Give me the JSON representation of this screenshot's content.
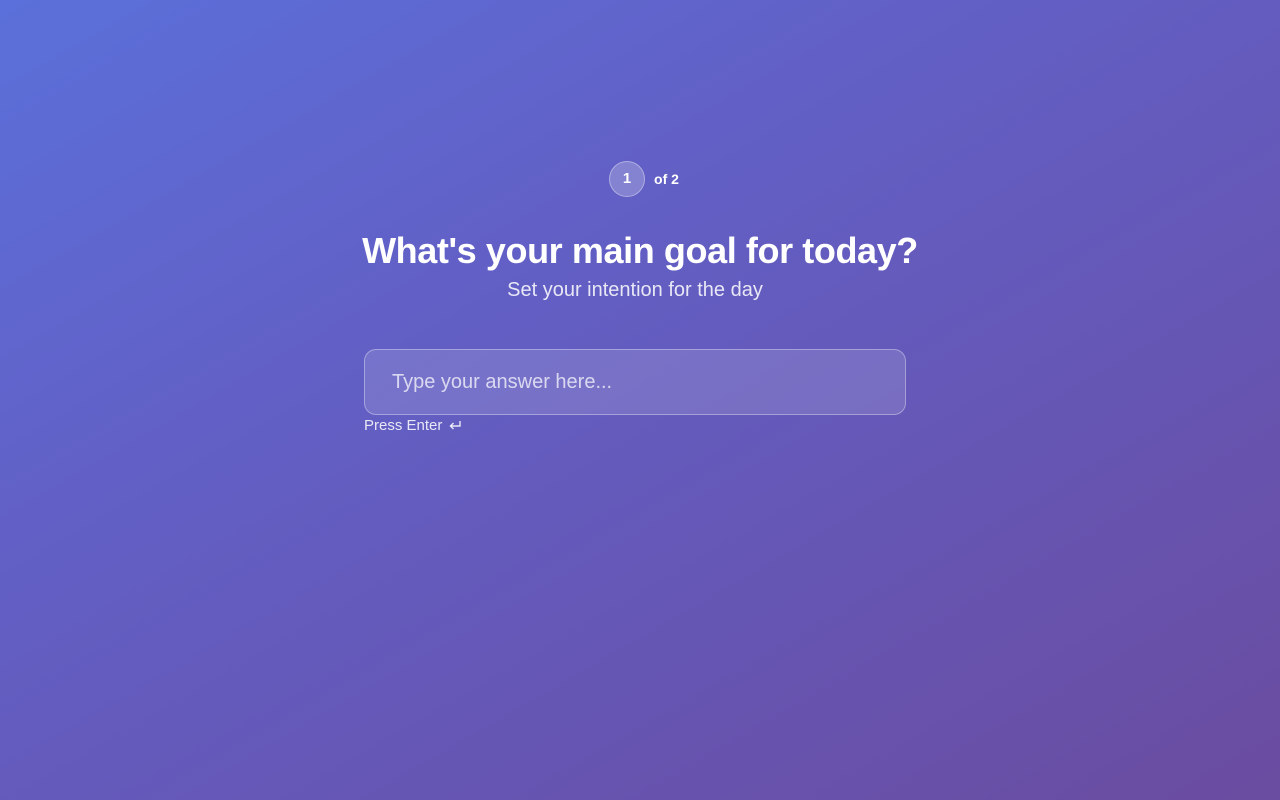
{
  "step": {
    "current": "1",
    "total_label": "of 2"
  },
  "question": {
    "title": "What's your main goal for today?",
    "subtitle": "Set your intention for the day"
  },
  "answer": {
    "value": "",
    "placeholder": "Type your answer here..."
  },
  "hint": {
    "label": "Press Enter",
    "icon": "enter-return-icon"
  },
  "colors": {
    "gradient_start": "#5b70da",
    "gradient_end": "#6a4ca0",
    "text": "#ffffff"
  }
}
